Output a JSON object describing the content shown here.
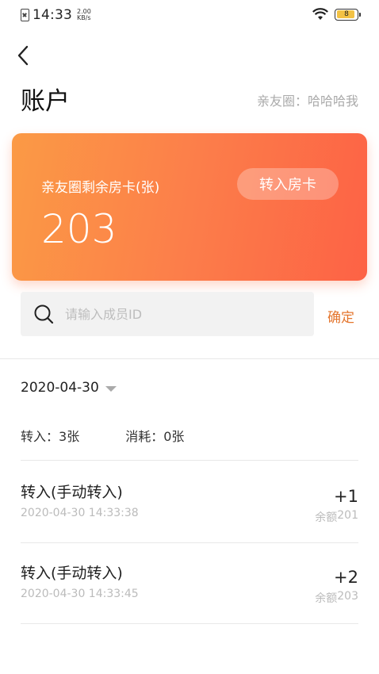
{
  "status_bar": {
    "time": "14:33",
    "speed_value": "2.00",
    "speed_unit": "KB/s",
    "battery": "8"
  },
  "header": {
    "title": "账户",
    "circle_label": "亲友圈：",
    "circle_name": "哈哈哈我"
  },
  "card": {
    "label": "亲友圈剩余房卡(张)",
    "value": "203",
    "transfer_button": "转入房卡"
  },
  "search": {
    "placeholder": "请输入成员ID",
    "confirm_label": "确定"
  },
  "date_filter": {
    "value": "2020-04-30"
  },
  "summary": {
    "in_label": "转入：",
    "in_value": "3张",
    "used_label": "消耗：",
    "used_value": "0张"
  },
  "records": [
    {
      "title": "转入(手动转入)",
      "time": "2020-04-30 14:33:38",
      "amount": "+1",
      "balance_label": "余额",
      "balance_value": "201"
    },
    {
      "title": "转入(手动转入)",
      "time": "2020-04-30 14:33:45",
      "amount": "+2",
      "balance_label": "余额",
      "balance_value": "203"
    }
  ],
  "colors": {
    "accent": "#e4762e",
    "card_start": "#fb9a45",
    "card_end": "#fd6245"
  }
}
